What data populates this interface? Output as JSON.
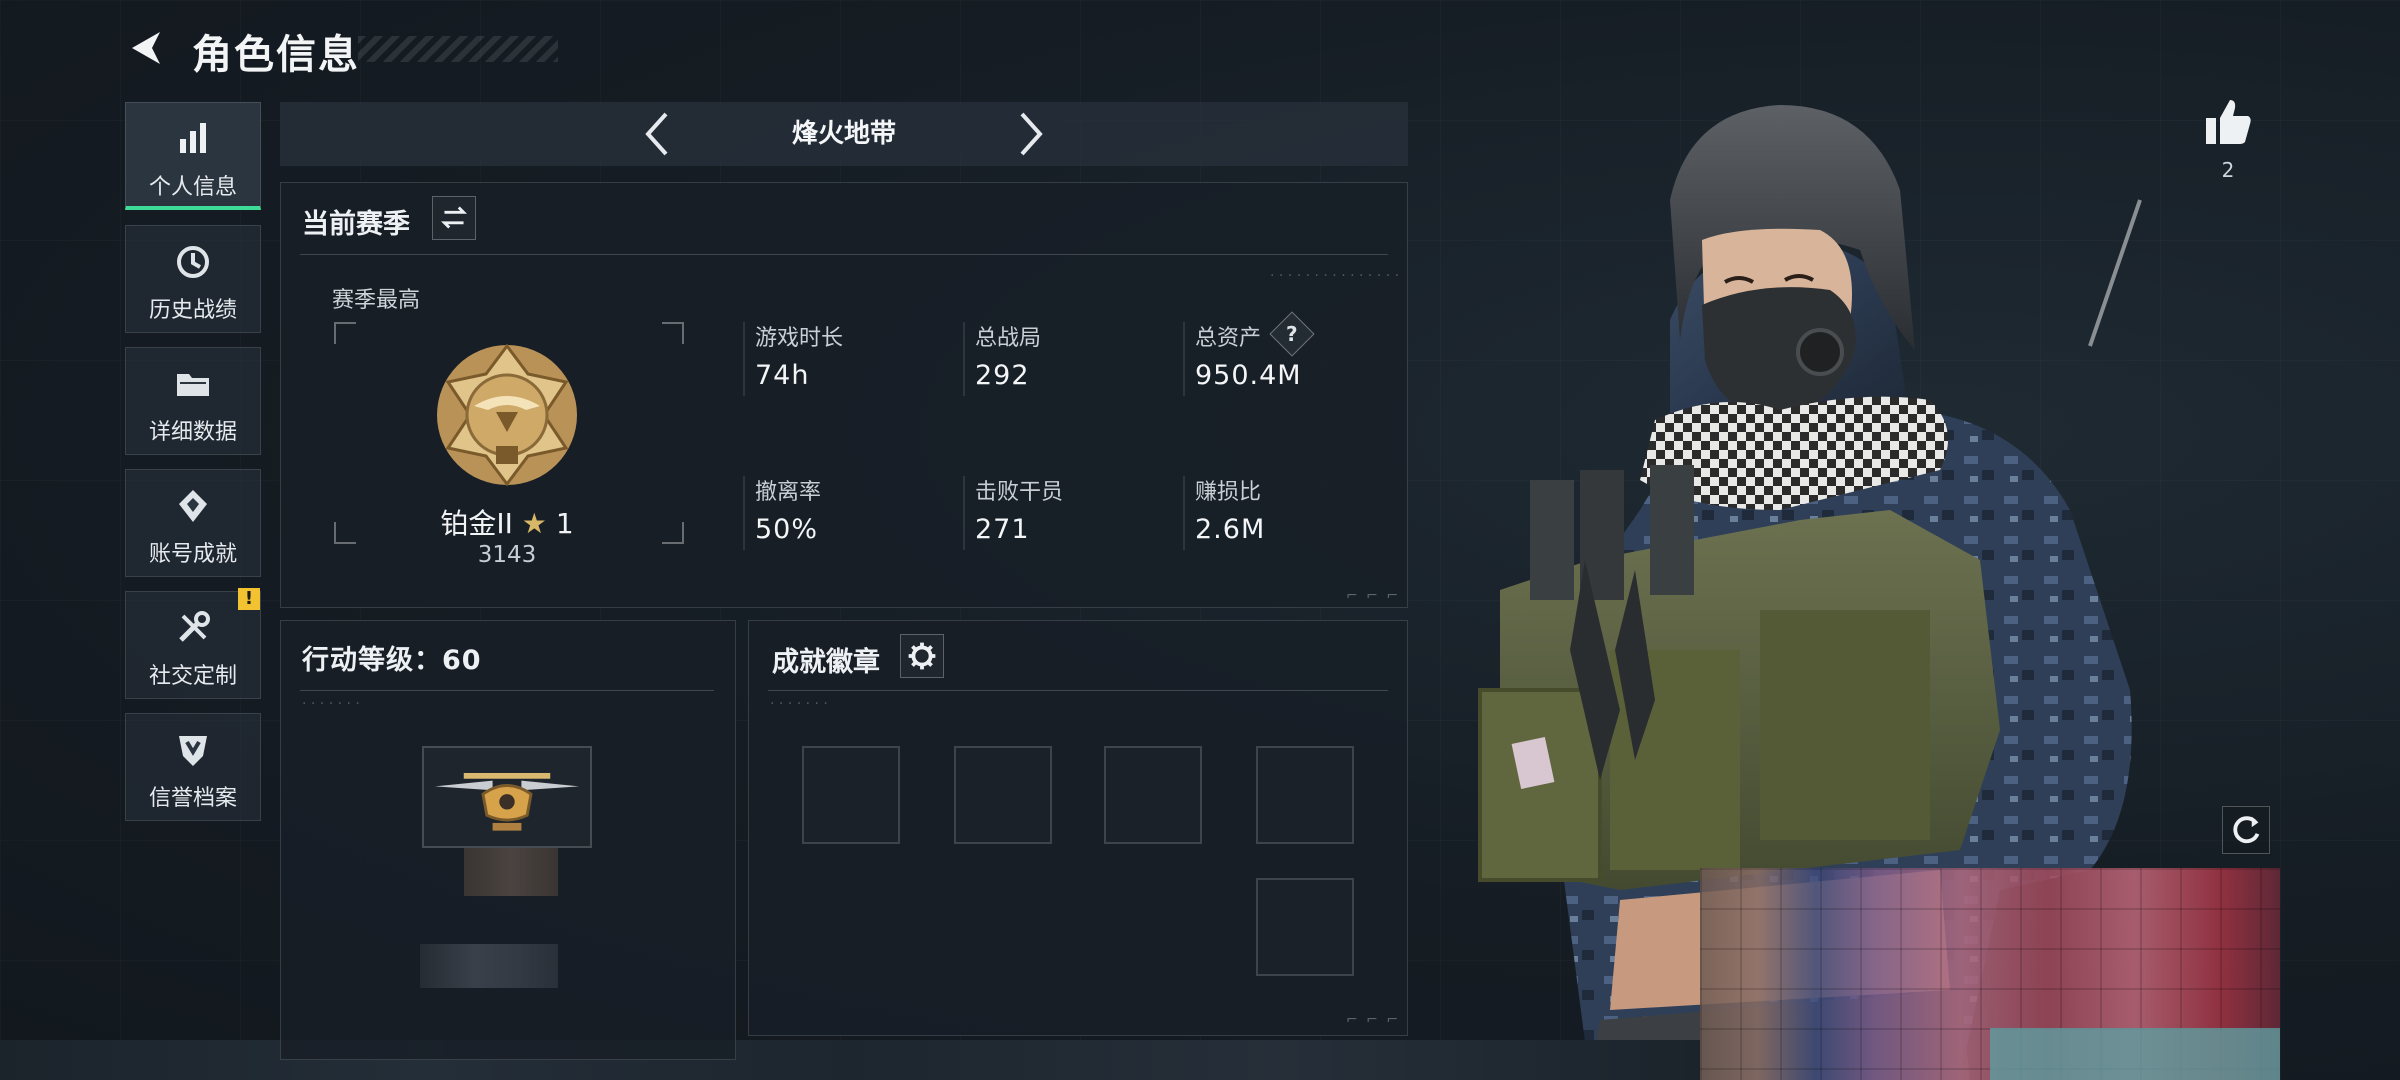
{
  "header": {
    "title": "角色信息"
  },
  "nav": {
    "items": [
      {
        "label": "个人信息",
        "icon": "bar-chart-icon"
      },
      {
        "label": "历史战绩",
        "icon": "history-icon"
      },
      {
        "label": "详细数据",
        "icon": "folder-icon"
      },
      {
        "label": "账号成就",
        "icon": "achievement-icon"
      },
      {
        "label": "社交定制",
        "icon": "tools-icon"
      },
      {
        "label": "信誉档案",
        "icon": "shield-icon"
      }
    ],
    "warning_badge": "!"
  },
  "mode": {
    "label": "烽火地带"
  },
  "season": {
    "title": "当前赛季",
    "best_label": "赛季最高",
    "rank_name": "铂金II",
    "rank_stars": "1",
    "rank_score": "3143",
    "stats": [
      {
        "label": "游戏时长",
        "value": "74h"
      },
      {
        "label": "总战局",
        "value": "292"
      },
      {
        "label": "总资产",
        "value": "950.4M",
        "help": "?"
      },
      {
        "label": "撤离率",
        "value": "50%"
      },
      {
        "label": "击败干员",
        "value": "271"
      },
      {
        "label": "赚损比",
        "value": "2.6M"
      }
    ]
  },
  "action_level": {
    "label": "行动等级：60"
  },
  "badges": {
    "title": "成就徽章"
  },
  "likes": {
    "count": "2"
  },
  "colors": {
    "accent": "#3ddc97",
    "warning": "#f2c230",
    "background": "#161d25"
  }
}
